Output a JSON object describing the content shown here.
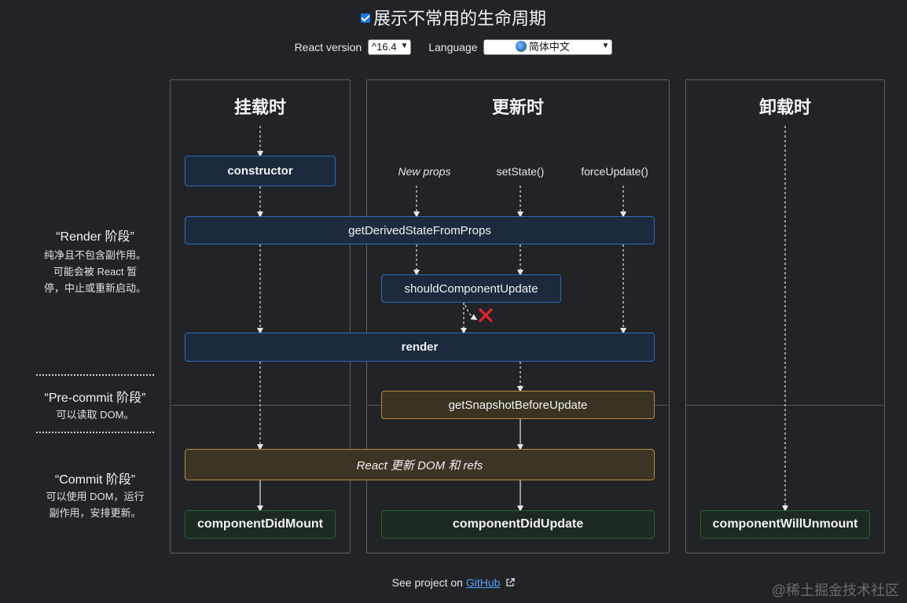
{
  "header": {
    "title": "展示不常用的生命周期",
    "show_uncommon_checked": true
  },
  "controls": {
    "version_label": "React version",
    "version_value": "^16.4",
    "language_label": "Language",
    "language_value": "简体中文"
  },
  "columns": {
    "mount": "挂载时",
    "update": "更新时",
    "unmount": "卸载时"
  },
  "triggers": {
    "new_props": "New props",
    "set_state": "setState()",
    "force_update": "forceUpdate()"
  },
  "nodes": {
    "constructor": "constructor",
    "get_derived_state": "getDerivedStateFromProps",
    "should_update": "shouldComponentUpdate",
    "render": "render",
    "get_snapshot": "getSnapshotBeforeUpdate",
    "react_updates_dom": "React 更新 DOM 和 refs",
    "did_mount": "componentDidMount",
    "did_update": "componentDidUpdate",
    "will_unmount": "componentWillUnmount"
  },
  "phases": {
    "render_name": "“Render 阶段”",
    "render_desc_1": "纯净且不包含副作用。",
    "render_desc_2": "可能会被 React 暂",
    "render_desc_3": "停，中止或重新启动。",
    "precommit_name": "“Pre-commit 阶段”",
    "precommit_desc_1": "可以读取 DOM。",
    "commit_name": "“Commit 阶段”",
    "commit_desc_1": "可以使用 DOM，运行",
    "commit_desc_2": "副作用，安排更新。"
  },
  "footer": {
    "prefix": "See project on ",
    "link": "GitHub",
    "external_icon": "external-link-icon"
  },
  "watermark": "@稀土掘金技术社区",
  "colors": {
    "background": "#212327",
    "render_border": "#2f6bb5",
    "commit_border": "#b78a3a",
    "did_border": "#2f5c3d",
    "cancel_x": "#e0262b"
  }
}
